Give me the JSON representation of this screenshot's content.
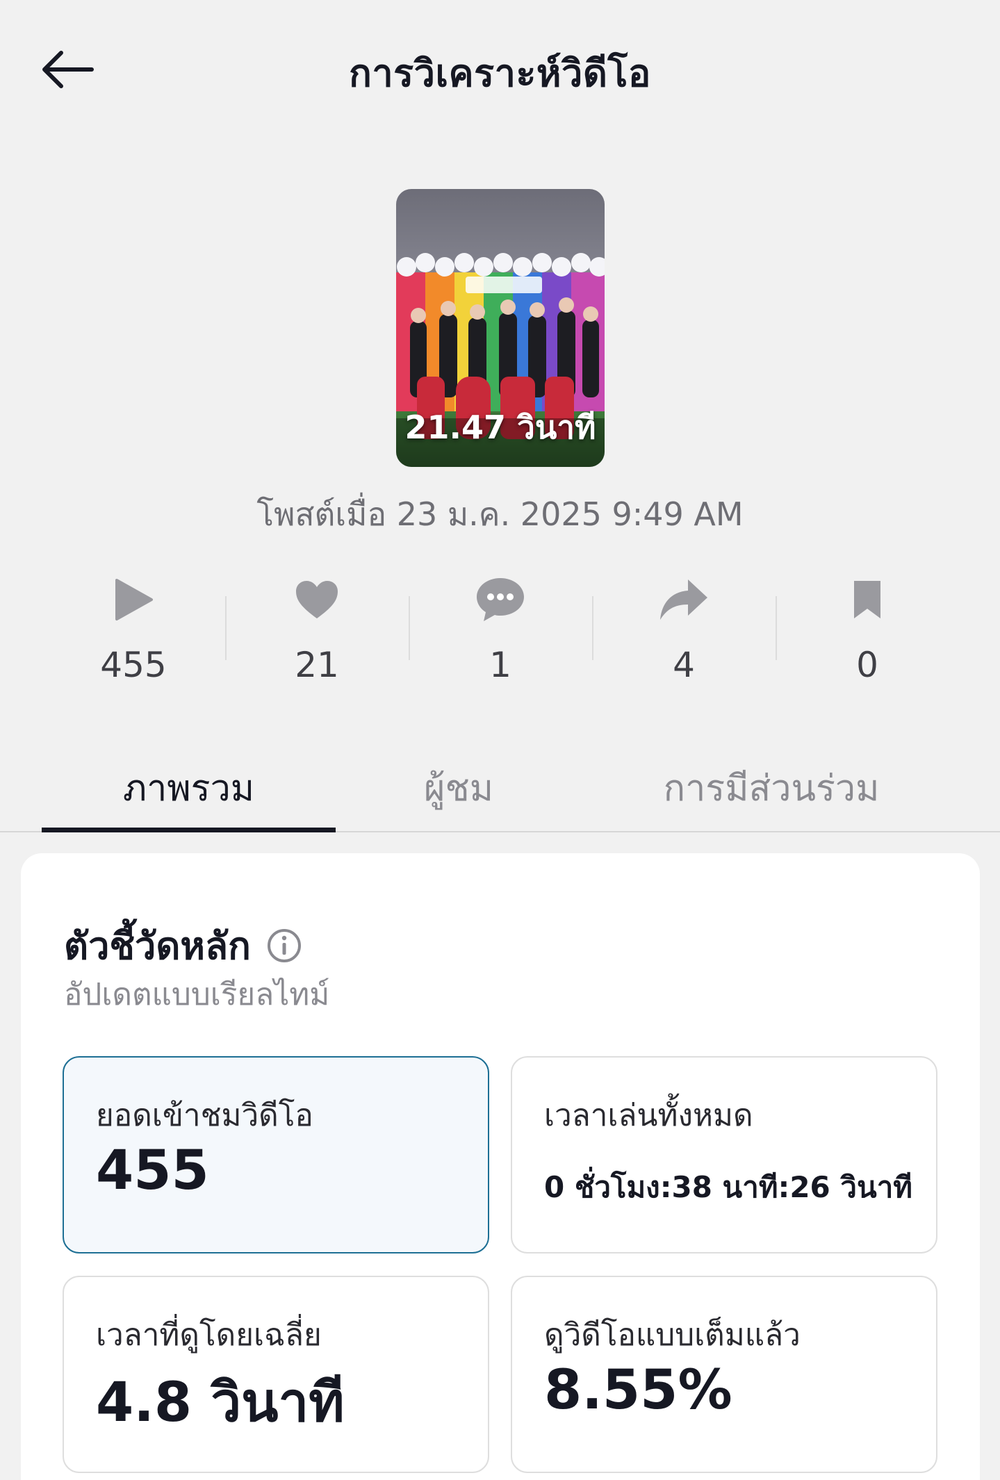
{
  "header": {
    "title": "การวิเคราะห์วิดีโอ"
  },
  "video": {
    "duration": "21.47 วินาที",
    "posted": "โพสต์เมื่อ 23 ม.ค. 2025 9:49 AM"
  },
  "stats": {
    "plays": "455",
    "likes": "21",
    "comments": "1",
    "shares": "4",
    "saves": "0"
  },
  "tabs": {
    "overview": "ภาพรวม",
    "audience": "ผู้ชม",
    "engagement": "การมีส่วนร่วม",
    "active": "overview"
  },
  "key_metrics": {
    "title": "ตัวชี้วัดหลัก",
    "subtitle": "อัปเดตแบบเรียลไทม์",
    "video_views_label": "ยอดเข้าชมวิดีโอ",
    "video_views_value": "455",
    "total_play_time_label": "เวลาเล่นทั้งหมด",
    "total_play_time_value": "0 ชั่วโมง:38 นาที:26 วินาที",
    "avg_watch_time_label": "เวลาที่ดูโดยเฉลี่ย",
    "avg_watch_time_value": "4.8 วินาที",
    "full_video_watched_label": "ดูวิดีโอแบบเต็มแล้ว",
    "full_video_watched_value": "8.55%"
  },
  "colors": {
    "background": "#f1f1f1",
    "text": "#161823",
    "muted": "#8a8a90",
    "icon": "#9a9a9f",
    "active_card_border": "#1d6f94",
    "active_card_bg": "#f4f8fc"
  },
  "icons": {
    "back": "arrow-left-icon",
    "plays": "play-icon",
    "likes": "heart-icon",
    "comments": "comment-icon",
    "shares": "share-icon",
    "saves": "bookmark-icon",
    "info": "info-icon"
  }
}
